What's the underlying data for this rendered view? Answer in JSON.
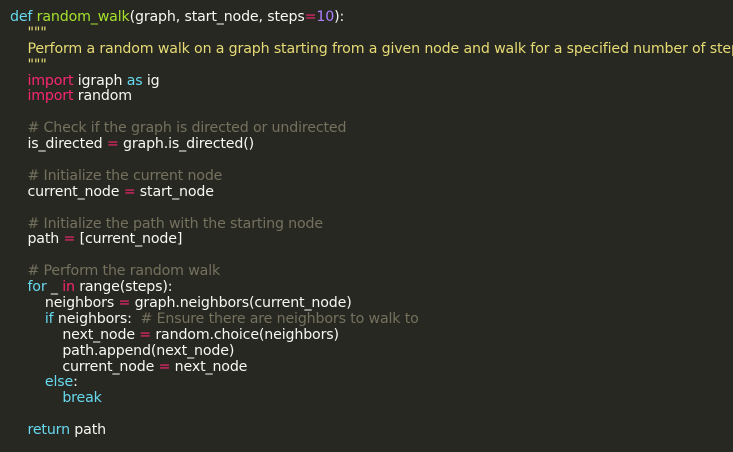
{
  "code": {
    "lines": [
      [
        {
          "t": "def ",
          "c": "kw"
        },
        {
          "t": "random_walk",
          "c": "fn"
        },
        {
          "t": "(graph, start_node, steps",
          "c": "pl"
        },
        {
          "t": "=",
          "c": "op"
        },
        {
          "t": "10",
          "c": "num"
        },
        {
          "t": "):",
          "c": "pl"
        }
      ],
      [
        {
          "t": "    \"\"\"",
          "c": "str"
        }
      ],
      [
        {
          "t": "    Perform a random walk on a graph starting from a given node and walk for a specified number of steps.",
          "c": "str"
        }
      ],
      [
        {
          "t": "    \"\"\"",
          "c": "str"
        }
      ],
      [
        {
          "t": "    ",
          "c": "pl"
        },
        {
          "t": "import",
          "c": "imp"
        },
        {
          "t": " igraph ",
          "c": "pl"
        },
        {
          "t": "as",
          "c": "kw"
        },
        {
          "t": " ig",
          "c": "pl"
        }
      ],
      [
        {
          "t": "    ",
          "c": "pl"
        },
        {
          "t": "import",
          "c": "imp"
        },
        {
          "t": " random",
          "c": "pl"
        }
      ],
      [],
      [
        {
          "t": "    # Check if the graph is directed or undirected",
          "c": "cmt"
        }
      ],
      [
        {
          "t": "    is_directed ",
          "c": "pl"
        },
        {
          "t": "=",
          "c": "op"
        },
        {
          "t": " graph.is_directed()",
          "c": "pl"
        }
      ],
      [],
      [
        {
          "t": "    # Initialize the current node",
          "c": "cmt"
        }
      ],
      [
        {
          "t": "    current_node ",
          "c": "pl"
        },
        {
          "t": "=",
          "c": "op"
        },
        {
          "t": " start_node",
          "c": "pl"
        }
      ],
      [],
      [
        {
          "t": "    # Initialize the path with the starting node",
          "c": "cmt"
        }
      ],
      [
        {
          "t": "    path ",
          "c": "pl"
        },
        {
          "t": "=",
          "c": "op"
        },
        {
          "t": " [current_node]",
          "c": "pl"
        }
      ],
      [],
      [
        {
          "t": "    # Perform the random walk",
          "c": "cmt"
        }
      ],
      [
        {
          "t": "    ",
          "c": "pl"
        },
        {
          "t": "for",
          "c": "kw"
        },
        {
          "t": " _ ",
          "c": "pl"
        },
        {
          "t": "in",
          "c": "imp"
        },
        {
          "t": " range(steps):",
          "c": "pl"
        }
      ],
      [
        {
          "t": "        neighbors ",
          "c": "pl"
        },
        {
          "t": "=",
          "c": "op"
        },
        {
          "t": " graph.neighbors(current_node)",
          "c": "pl"
        }
      ],
      [
        {
          "t": "        ",
          "c": "pl"
        },
        {
          "t": "if",
          "c": "kw"
        },
        {
          "t": " neighbors:  ",
          "c": "pl"
        },
        {
          "t": "# Ensure there are neighbors to walk to",
          "c": "cmt"
        }
      ],
      [
        {
          "t": "            next_node ",
          "c": "pl"
        },
        {
          "t": "=",
          "c": "op"
        },
        {
          "t": " random.choice(neighbors)",
          "c": "pl"
        }
      ],
      [
        {
          "t": "            path.append(next_node)",
          "c": "pl"
        }
      ],
      [
        {
          "t": "            current_node ",
          "c": "pl"
        },
        {
          "t": "=",
          "c": "op"
        },
        {
          "t": " next_node",
          "c": "pl"
        }
      ],
      [
        {
          "t": "        ",
          "c": "pl"
        },
        {
          "t": "else",
          "c": "kw"
        },
        {
          "t": ":",
          "c": "pl"
        }
      ],
      [
        {
          "t": "            ",
          "c": "pl"
        },
        {
          "t": "break",
          "c": "kw"
        }
      ],
      [],
      [
        {
          "t": "    ",
          "c": "pl"
        },
        {
          "t": "return",
          "c": "kw"
        },
        {
          "t": " path",
          "c": "pl"
        }
      ]
    ]
  }
}
